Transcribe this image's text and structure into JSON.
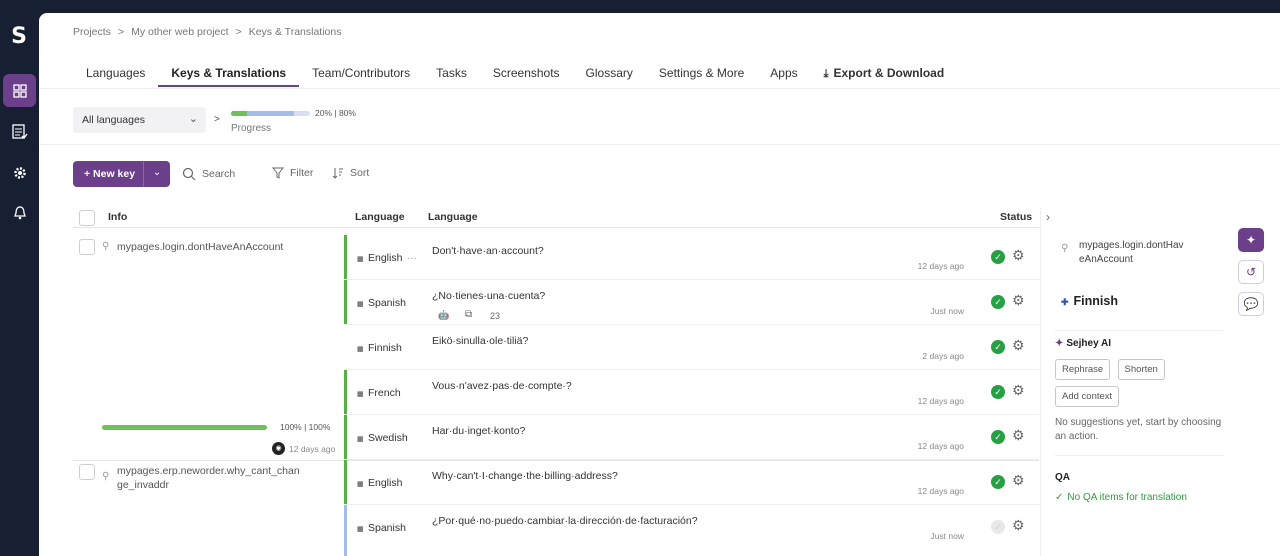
{
  "sidebar": {
    "logo": "S",
    "items": [
      {
        "name": "dashboard",
        "active": true
      },
      {
        "name": "tasks",
        "active": false
      },
      {
        "name": "settings",
        "active": false
      },
      {
        "name": "notifications",
        "active": false
      }
    ]
  },
  "breadcrumb": [
    "Projects",
    ">",
    "My other web project",
    ">",
    "Keys & Translations"
  ],
  "tabs": [
    {
      "label": "Languages"
    },
    {
      "label": "Keys & Translations",
      "active": true
    },
    {
      "label": "Team/Contributors"
    },
    {
      "label": "Tasks"
    },
    {
      "label": "Screenshots"
    },
    {
      "label": "Glossary"
    },
    {
      "label": "Settings & More"
    },
    {
      "label": "Apps"
    },
    {
      "label": "Export & Download"
    }
  ],
  "filters": {
    "language_select": "All languages",
    "separator": ">",
    "progress_label": "Progress",
    "progress_pct": "20% | 80%",
    "progress_done": 0.2,
    "progress_total": 0.8
  },
  "toolbar": {
    "new_key": "+ New key",
    "search": "Search",
    "filter": "Filter",
    "sort": "Sort"
  },
  "table": {
    "headers": {
      "info": "Info",
      "language1": "Language",
      "language2": "Language",
      "status": "Status"
    },
    "keys": [
      {
        "name": "mypages.login.dontHaveAnAccount",
        "progress_pct": "100% | 100%",
        "progress": 1.0,
        "updated": "12 days ago",
        "translations": [
          {
            "lang": "English",
            "flag": "🇬🇧",
            "text": "Don't·have·an·account?",
            "time": "12 days ago",
            "status": "done"
          },
          {
            "lang": "Spanish",
            "flag": "🇪🇸",
            "text": "¿No·tienes·una·cuenta?",
            "time": "Just now",
            "status": "done",
            "char_count": "23"
          },
          {
            "lang": "Finnish",
            "flag": "🇫🇮",
            "text": "Eikö·sinulla·ole·tiliä?",
            "time": "2 days ago",
            "status": "done"
          },
          {
            "lang": "French",
            "flag": "🇫🇷",
            "text": "Vous·n'avez·pas·de·compte·?",
            "time": "12 days ago",
            "status": "done"
          },
          {
            "lang": "Swedish",
            "flag": "🇸🇪",
            "text": "Har·du·inget·konto?",
            "time": "12 days ago",
            "status": "done"
          }
        ]
      },
      {
        "name": "mypages.erp.neworder.why_cant_change_invaddr",
        "translations": [
          {
            "lang": "English",
            "flag": "🇬🇧",
            "text": "Why·can't·I·change·the·billing·address?",
            "time": "12 days ago",
            "status": "done"
          },
          {
            "lang": "Spanish",
            "flag": "🇪🇸",
            "text": "¿Por·qué·no·puedo·cambiar·la·dirección·de·facturación?",
            "time": "Just now",
            "status": "pending"
          }
        ]
      }
    ]
  },
  "panel": {
    "key": "mypages.login.dontHaveAnAccount",
    "language": "Finnish",
    "ai_title": "Sejhey AI",
    "actions": [
      "Rephrase",
      "Shorten",
      "Add context"
    ],
    "ai_empty": "No suggestions yet, start by choosing an action.",
    "qa_title": "QA",
    "qa_msg": "No QA items for translation"
  }
}
